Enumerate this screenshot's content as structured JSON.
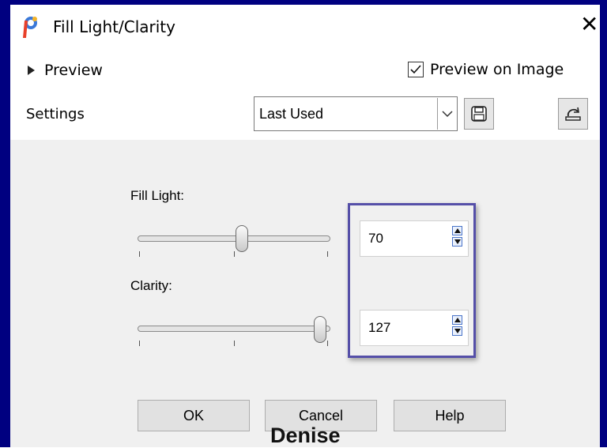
{
  "window": {
    "title": "Fill Light/Clarity",
    "close_glyph": "✕",
    "icon": "paint-shop-pro-icon"
  },
  "header": {
    "preview_toggle_label": "Preview",
    "preview_on_image_label": "Preview on Image",
    "preview_on_image_checked": true
  },
  "settings": {
    "label": "Settings",
    "selected": "Last Used",
    "save_icon": "floppy-disk-icon",
    "reset_icon": "reset-defaults-icon"
  },
  "controls": {
    "fill_light": {
      "label": "Fill Light:",
      "value": "70",
      "min": 0,
      "max": 100
    },
    "clarity": {
      "label": "Clarity:",
      "value": "127",
      "min": 0,
      "max": 127
    }
  },
  "buttons": {
    "ok": "OK",
    "cancel": "Cancel",
    "help": "Help"
  },
  "watermark": "Denise",
  "colors": {
    "frame": "#000080",
    "highlight": "#554fa8",
    "panel": "#f0f0f0"
  }
}
